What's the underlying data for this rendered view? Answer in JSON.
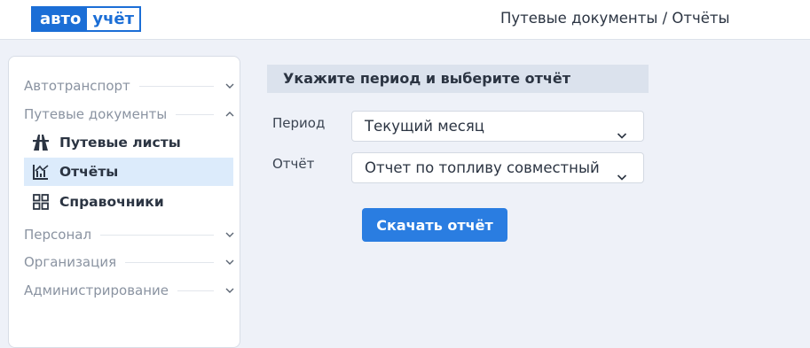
{
  "header": {
    "logo_part1": "авто",
    "logo_part2": "учёт",
    "breadcrumb": "Путевые документы / Отчёты"
  },
  "sidebar": {
    "sections": [
      {
        "label": "Автотранспорт",
        "expanded": false
      },
      {
        "label": "Путевые документы",
        "expanded": true
      },
      {
        "label": "Персонал",
        "expanded": false
      },
      {
        "label": "Организация",
        "expanded": false
      },
      {
        "label": "Администрирование",
        "expanded": false
      }
    ],
    "subitems": [
      {
        "label": "Путевые листы",
        "icon": "road-icon",
        "active": false
      },
      {
        "label": "Отчёты",
        "icon": "chart-icon",
        "active": true
      },
      {
        "label": "Справочники",
        "icon": "grid-icon",
        "active": false
      }
    ]
  },
  "main": {
    "title": "Укажите период и выберите отчёт",
    "period_label": "Период",
    "period_value": "Текущий месяц",
    "report_label": "Отчёт",
    "report_value": "Отчет по топливу совместный",
    "download_label": "Скачать отчёт"
  },
  "colors": {
    "accent": "#2a7de1",
    "brand": "#1b6ed6",
    "active_item_bg": "#dcebfb",
    "page_bg": "#eef1f8"
  }
}
